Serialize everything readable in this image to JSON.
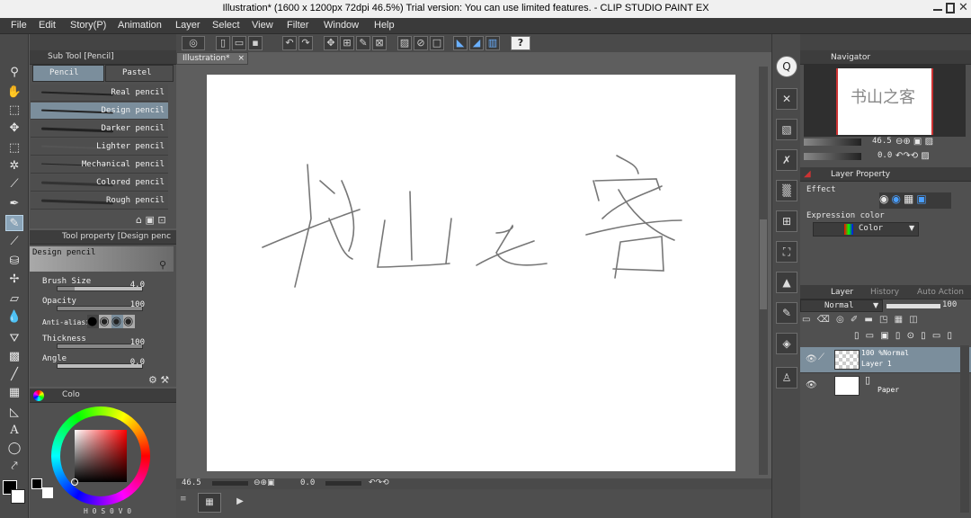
{
  "window": {
    "title": "Illustration* (1600 x 1200px 72dpi 46.5%)  Trial version: You can use limited features. - CLIP STUDIO PAINT EX"
  },
  "menu": [
    "File",
    "Edit",
    "Story(P)",
    "Animation",
    "Layer",
    "Select",
    "View",
    "Filter",
    "Window",
    "Help"
  ],
  "sub_tool": {
    "header": "Sub Tool [Pencil]",
    "tabs": [
      "Pencil",
      "Pastel"
    ],
    "brushes": [
      "Real pencil",
      "Design pencil",
      "Darker pencil",
      "Lighter pencil",
      "Mechanical pencil",
      "Colored pencil",
      "Rough pencil"
    ],
    "selected_index": 1
  },
  "tool_property": {
    "header": "Tool property [Design penc",
    "preset_name": "Design pencil",
    "brush_size_label": "Brush Size",
    "brush_size_value": "4.0",
    "opacity_label": "Opacity",
    "opacity_value": "100",
    "antialias_label": "Anti-aliasing",
    "thickness_label": "Thickness",
    "thickness_value": "100",
    "angle_label": "Angle",
    "angle_value": "0.0"
  },
  "color_panel": {
    "tab_label": "Colo",
    "hsv_labels": [
      "H",
      "S",
      "V"
    ],
    "hsv_values": [
      "0",
      "0",
      "0"
    ],
    "main_color": "#000000",
    "sub_color": "#ffffff"
  },
  "canvas": {
    "tab_label": "Illustration*",
    "handwriting_text": "书山之客"
  },
  "status": {
    "zoom": "46.5",
    "angle": "0.0"
  },
  "navigator": {
    "tab_label": "Navigator",
    "zoom": "46.5",
    "rotation": "0.0"
  },
  "layer_property": {
    "tab_label": "Layer Property",
    "effect_label": "Effect",
    "expression_label": "Expression color",
    "expression_value": "Color"
  },
  "layer_panel": {
    "tabs": [
      "Layer",
      "History",
      "Auto Action"
    ],
    "blend_mode": "Normal",
    "opacity": "100",
    "layers": [
      {
        "top_label": "100 %Normal",
        "name": "Layer 1",
        "selected": true
      },
      {
        "top_label": "",
        "name": "Paper",
        "selected": false
      }
    ]
  },
  "colors": {
    "accent": "#8aa4b8",
    "panel_bg": "#505050",
    "canvas_bg": "#ffffff"
  }
}
